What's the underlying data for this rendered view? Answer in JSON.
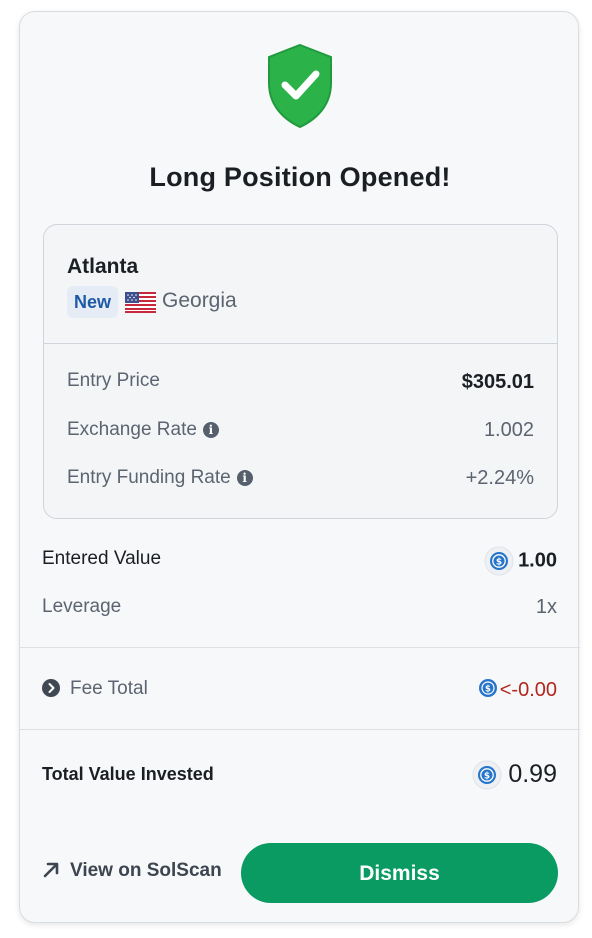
{
  "header": {
    "title": "Long Position Opened!",
    "icon": "shield-check-icon"
  },
  "market": {
    "city": "Atlanta",
    "badge": "New",
    "flag_icon": "us-flag-icon",
    "state": "Georgia"
  },
  "details": {
    "entry_price_label": "Entry Price",
    "entry_price_value": "$305.01",
    "exchange_rate_label": "Exchange Rate",
    "exchange_rate_value": "1.002",
    "funding_rate_label": "Entry Funding Rate",
    "funding_rate_value": "+2.24%"
  },
  "summary": {
    "entered_value_label": "Entered Value",
    "entered_value": "1.00",
    "leverage_label": "Leverage",
    "leverage_value": "1x",
    "fee_total_label": "Fee Total",
    "fee_total_value": "<-0.00",
    "total_invested_label": "Total Value Invested",
    "total_invested_value": "0.99",
    "currency_icon": "usdc-icon"
  },
  "actions": {
    "solscan_label": "View on SolScan",
    "dismiss_label": "Dismiss"
  },
  "colors": {
    "accent_green": "#0a9b63",
    "shield_green": "#2bb34a",
    "negative_red": "#b3261e",
    "badge_blue": "#1f5aa6",
    "usdc_blue": "#2775ca"
  }
}
